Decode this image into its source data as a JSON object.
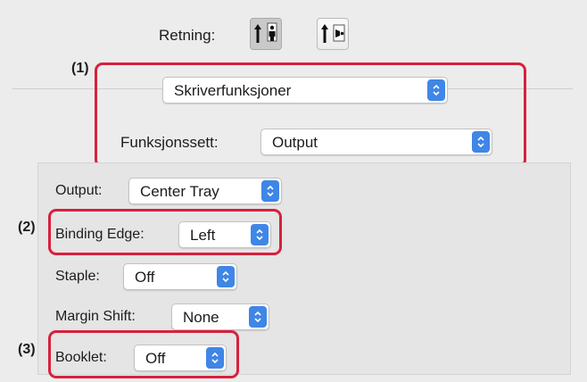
{
  "orientation": {
    "label": "Retning:",
    "portrait_icon": "portrait-person-icon",
    "landscape_icon": "landscape-person-icon"
  },
  "callout_markers": {
    "m1": "(1)",
    "m2": "(2)",
    "m3": "(3)"
  },
  "panel_menu": {
    "value": "Skriverfunksjoner"
  },
  "feature_set": {
    "label": "Funksjonssett:",
    "value": "Output"
  },
  "settings": {
    "output": {
      "label": "Output:",
      "value": "Center Tray"
    },
    "binding_edge": {
      "label": "Binding Edge:",
      "value": "Left"
    },
    "staple": {
      "label": "Staple:",
      "value": "Off"
    },
    "margin_shift": {
      "label": "Margin Shift:",
      "value": "None"
    },
    "booklet": {
      "label": "Booklet:",
      "value": "Off"
    }
  },
  "colors": {
    "accent": "#3f86e6",
    "callout": "#d7203d"
  }
}
